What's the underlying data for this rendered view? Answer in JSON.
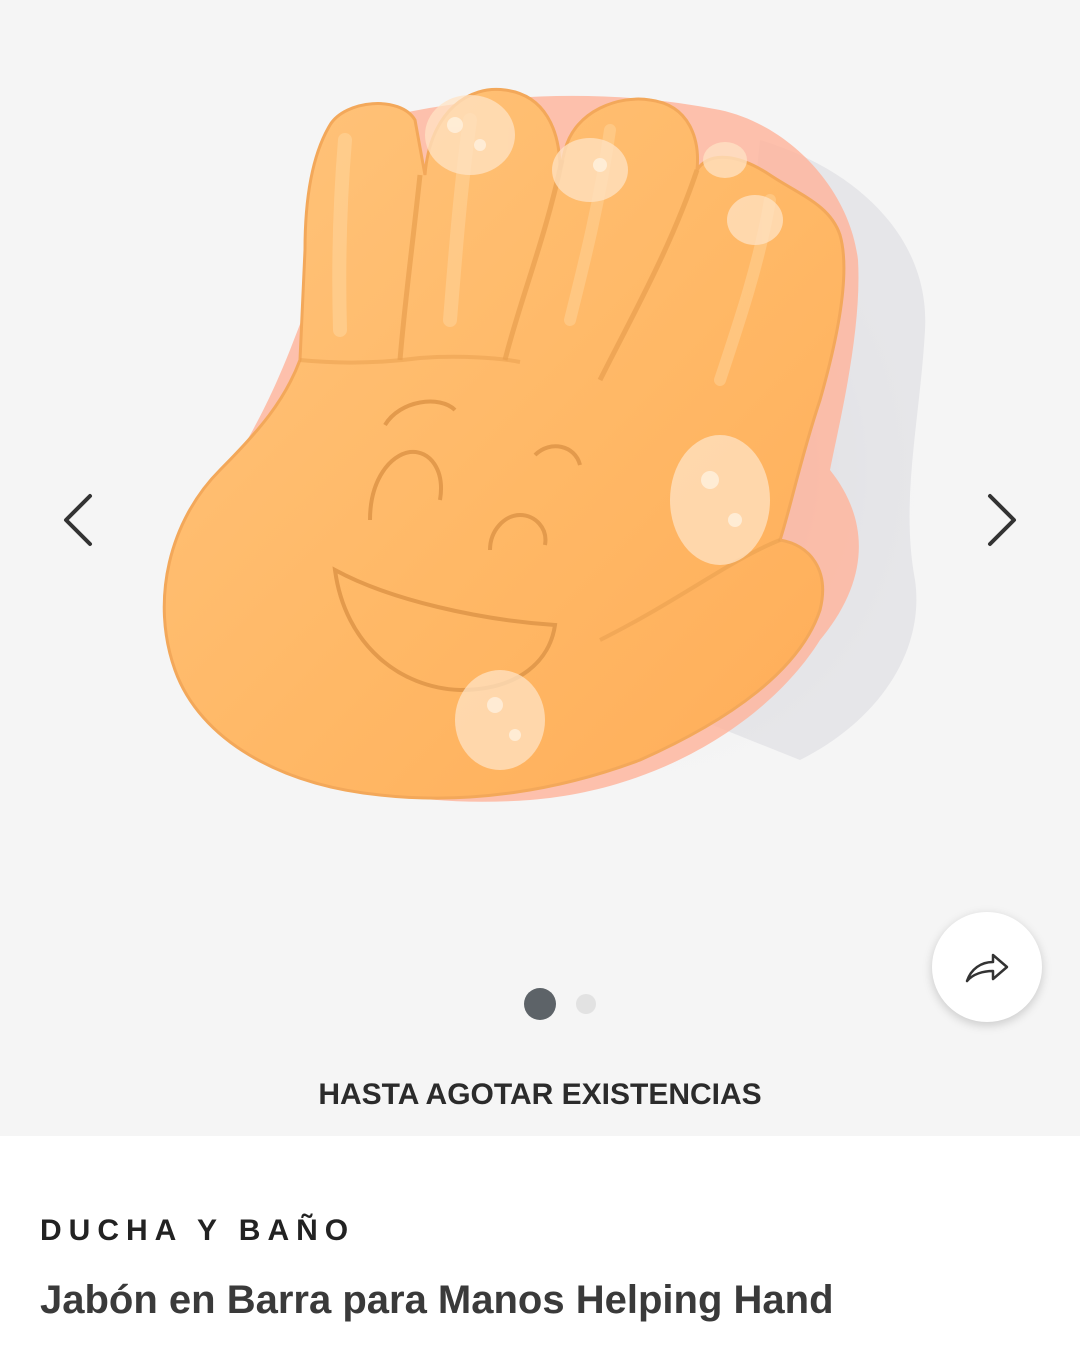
{
  "gallery": {
    "image_alt": "Helping Hand soap bar",
    "stock_label": "HASTA AGOTAR EXISTENCIAS",
    "current_slide": 1,
    "total_slides": 2,
    "prev_icon": "chevron-left-icon",
    "next_icon": "chevron-right-icon",
    "share_icon": "share-arrow-icon",
    "background_color": "#f5f5f5",
    "soap_color": "#ffb766"
  },
  "product": {
    "category": "DUCHA Y BAÑO",
    "title": "Jabón en Barra para Manos Helping Hand"
  }
}
